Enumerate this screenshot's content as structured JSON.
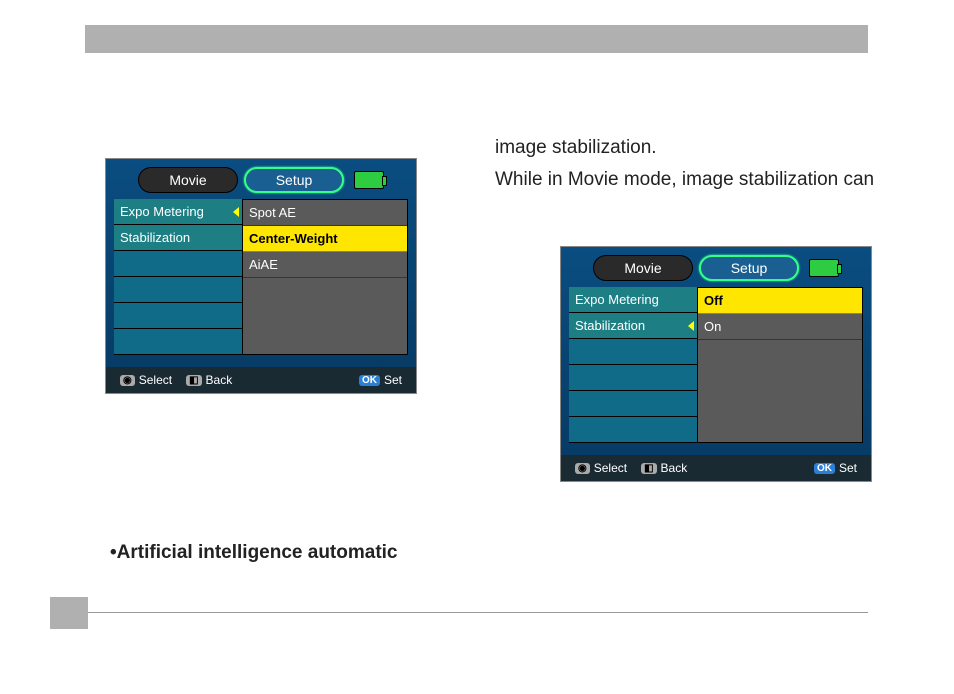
{
  "text": {
    "line1": "image stabilization.",
    "line2": "While in Movie mode, image stabilization can",
    "bullet": "•Artificial intelligence automatic"
  },
  "ss1": {
    "tabs": {
      "movie": "Movie",
      "setup": "Setup"
    },
    "left": [
      "Expo Metering",
      "Stabilization"
    ],
    "right": [
      "Spot AE",
      "Center-Weight",
      "AiAE"
    ],
    "selectedLeft": 0,
    "highlightRight": 1,
    "footer": {
      "select": "Select",
      "back": "Back",
      "set": "Set"
    }
  },
  "ss2": {
    "tabs": {
      "movie": "Movie",
      "setup": "Setup"
    },
    "left": [
      "Expo Metering",
      "Stabilization"
    ],
    "right": [
      "Off",
      "On"
    ],
    "selectedLeft": 1,
    "highlightRight": 0,
    "footer": {
      "select": "Select",
      "back": "Back",
      "set": "Set"
    }
  }
}
